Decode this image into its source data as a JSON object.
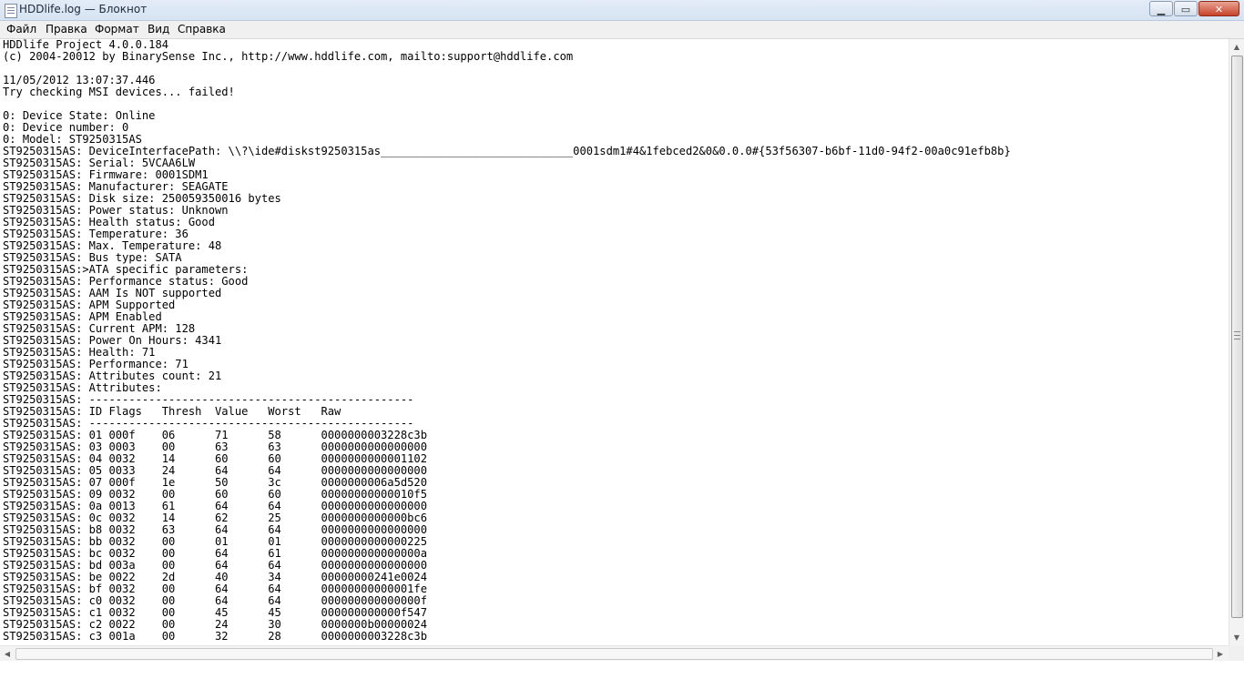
{
  "window": {
    "title": "HDDlife.log — Блокнот",
    "minimize_glyph": "▁",
    "maximize_glyph": "▭",
    "close_glyph": "✕"
  },
  "menu": [
    "Файл",
    "Правка",
    "Формат",
    "Вид",
    "Справка"
  ],
  "scrollbar": {
    "up_arrow": "▲",
    "down_arrow": "▼",
    "left_arrow": "◀",
    "right_arrow": "▶"
  },
  "document": {
    "lines": [
      "HDDlife Project 4.0.0.184",
      "(c) 2004-20012 by BinarySense Inc., http://www.hddlife.com, mailto:support@hddlife.com",
      "",
      "11/05/2012 13:07:37.446",
      "Try checking MSI devices... failed!",
      "",
      "0: Device State: Online",
      "0: Device number: 0",
      "0: Model: ST9250315AS",
      "ST9250315AS: DeviceInterfacePath: \\\\?\\ide#diskst9250315as_____________________________0001sdm1#4&1febced2&0&0.0.0#{53f56307-b6bf-11d0-94f2-00a0c91efb8b}",
      "ST9250315AS: Serial: 5VCAA6LW",
      "ST9250315AS: Firmware: 0001SDM1",
      "ST9250315AS: Manufacturer: SEAGATE",
      "ST9250315AS: Disk size: 250059350016 bytes",
      "ST9250315AS: Power status: Unknown",
      "ST9250315AS: Health status: Good",
      "ST9250315AS: Temperature: 36",
      "ST9250315AS: Max. Temperature: 48",
      "ST9250315AS: Bus type: SATA",
      "ST9250315AS:>ATA specific parameters:",
      "ST9250315AS: Performance status: Good",
      "ST9250315AS: AAM Is NOT supported",
      "ST9250315AS: APM Supported",
      "ST9250315AS: APM Enabled",
      "ST9250315AS: Current APM: 128",
      "ST9250315AS: Power On Hours: 4341",
      "ST9250315AS: Health: 71",
      "ST9250315AS: Performance: 71",
      "ST9250315AS: Attributes count: 21",
      "ST9250315AS: Attributes:",
      "ST9250315AS: -------------------------------------------------",
      "ST9250315AS: ID Flags   Thresh  Value   Worst   Raw",
      "ST9250315AS: -------------------------------------------------",
      "ST9250315AS: 01 000f    06      71      58      0000000003228c3b",
      "ST9250315AS: 03 0003    00      63      63      0000000000000000",
      "ST9250315AS: 04 0032    14      60      60      0000000000001102",
      "ST9250315AS: 05 0033    24      64      64      0000000000000000",
      "ST9250315AS: 07 000f    1e      50      3c      0000000006a5d520",
      "ST9250315AS: 09 0032    00      60      60      00000000000010f5",
      "ST9250315AS: 0a 0013    61      64      64      0000000000000000",
      "ST9250315AS: 0c 0032    14      62      25      0000000000000bc6",
      "ST9250315AS: b8 0032    63      64      64      0000000000000000",
      "ST9250315AS: bb 0032    00      01      01      0000000000000225",
      "ST9250315AS: bc 0032    00      64      61      000000000000000a",
      "ST9250315AS: bd 003a    00      64      64      0000000000000000",
      "ST9250315AS: be 0022    2d      40      34      00000000241e0024",
      "ST9250315AS: bf 0032    00      64      64      00000000000001fe",
      "ST9250315AS: c0 0032    00      64      64      000000000000000f",
      "ST9250315AS: c1 0032    00      45      45      000000000000f547",
      "ST9250315AS: c2 0022    00      24      30      0000000b00000024",
      "ST9250315AS: c3 001a    00      32      28      0000000003228c3b"
    ]
  }
}
